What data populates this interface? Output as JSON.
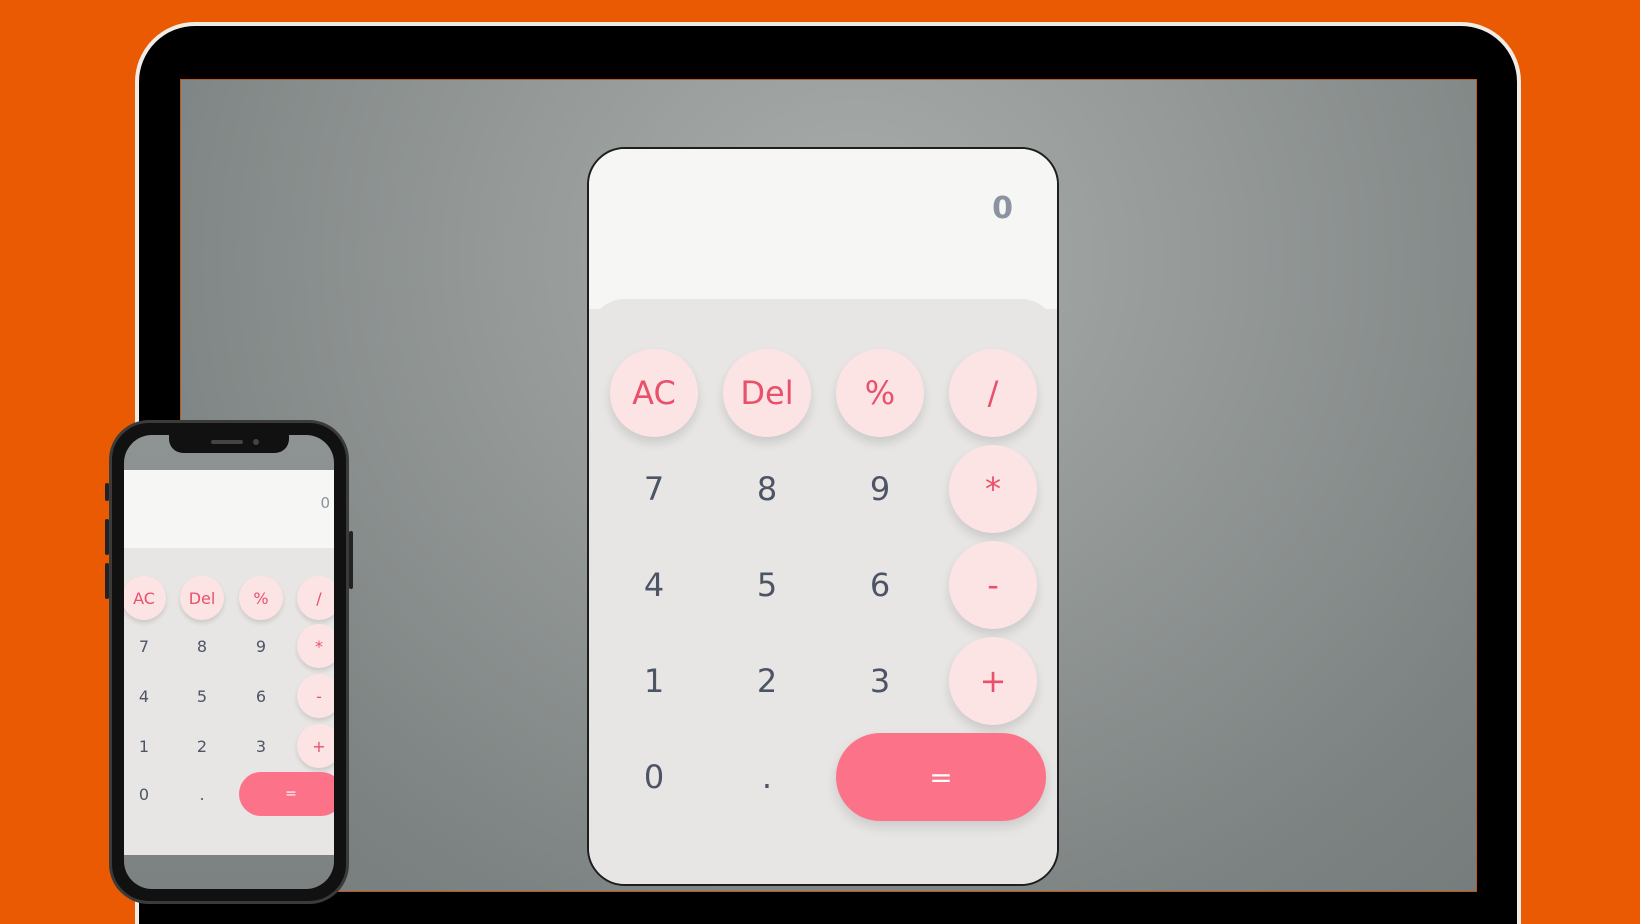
{
  "display": {
    "value": "0"
  },
  "keys": {
    "ac": "AC",
    "del": "Del",
    "percent": "%",
    "divide": "/",
    "seven": "7",
    "eight": "8",
    "nine": "9",
    "multiply": "*",
    "four": "4",
    "five": "5",
    "six": "6",
    "minus": "-",
    "one": "1",
    "two": "2",
    "three": "3",
    "plus": "+",
    "zero": "0",
    "dot": ".",
    "equals": "="
  },
  "colors": {
    "background": "#E95A03",
    "display_bg": "#F6F6F5",
    "keypad_bg": "#E7E6E5",
    "function_key_bg": "#FDE4E4",
    "function_key_text": "#E8506C",
    "equals_bg": "#FC7288",
    "digit_text": "#4D5565"
  }
}
